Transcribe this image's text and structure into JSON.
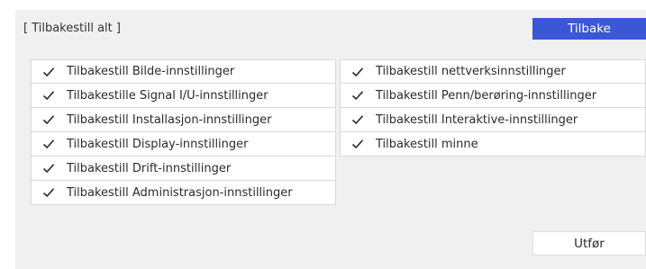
{
  "dialog": {
    "title": "[ Tilbakestill alt ]",
    "back_label": "Tilbake",
    "run_label": "Utfør",
    "accent_color": "#3b57d6"
  },
  "left_options": [
    {
      "label": "Tilbakestill Bilde-innstillinger",
      "checked": true
    },
    {
      "label": "Tilbakestille Signal I/U-innstillinger",
      "checked": true
    },
    {
      "label": "Tilbakestill Installasjon-innstillinger",
      "checked": true
    },
    {
      "label": "Tilbakestill Display-innstillinger",
      "checked": true
    },
    {
      "label": "Tilbakestill Drift-innstillinger",
      "checked": true
    },
    {
      "label": "Tilbakestill Administrasjon-innstillinger",
      "checked": true
    }
  ],
  "right_options": [
    {
      "label": "Tilbakestill nettverksinnstillinger",
      "checked": true
    },
    {
      "label": "Tilbakestill Penn/berøring-innstillinger",
      "checked": true
    },
    {
      "label": "Tilbakestill Interaktive-innstillinger",
      "checked": true
    },
    {
      "label": "Tilbakestill minne",
      "checked": true
    }
  ],
  "icons": {
    "check": "check-icon"
  }
}
